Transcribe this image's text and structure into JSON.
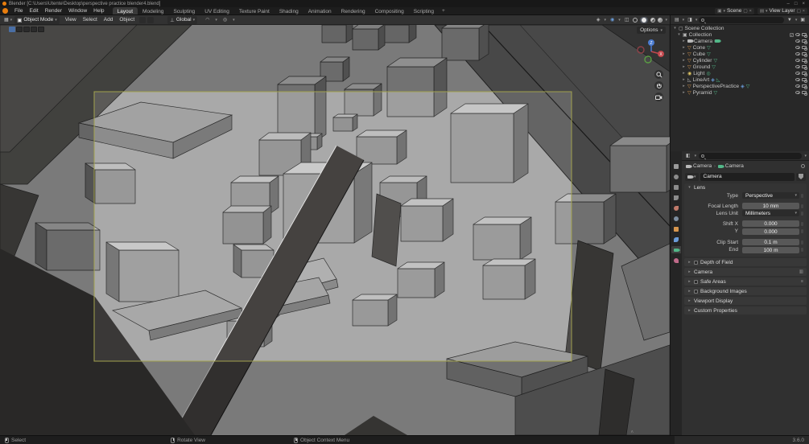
{
  "window": {
    "title": "Blender [C:\\Users\\Utente\\Desktop\\perspective practice blender4.blend]",
    "minimize": "–",
    "maximize": "□",
    "close": "×"
  },
  "menubar": {
    "menus": [
      "File",
      "Edit",
      "Render",
      "Window",
      "Help"
    ],
    "tabs": [
      "Layout",
      "Modeling",
      "Sculpting",
      "UV Editing",
      "Texture Paint",
      "Shading",
      "Animation",
      "Rendering",
      "Compositing",
      "Scripting"
    ],
    "active_tab": "Layout",
    "add_workspace": "+",
    "scene_selector": {
      "label": "Scene"
    },
    "view_layer_selector": {
      "label": "View Layer"
    }
  },
  "viewport_header": {
    "mode": "Object Mode",
    "menus": [
      "View",
      "Select",
      "Add",
      "Object"
    ],
    "orientation": "Global",
    "options_label": "Options"
  },
  "outliner": {
    "root": "Scene Collection",
    "collection": "Collection",
    "items": [
      {
        "name": "Camera"
      },
      {
        "name": "Cone"
      },
      {
        "name": "Cube"
      },
      {
        "name": "Cylinder"
      },
      {
        "name": "Ground"
      },
      {
        "name": "Light"
      },
      {
        "name": "LineArt"
      },
      {
        "name": "PerspectivePractice"
      },
      {
        "name": "Pyramid"
      }
    ]
  },
  "properties": {
    "breadcrumb_object": "Camera",
    "breadcrumb_sep": "›",
    "breadcrumb_data": "Camera",
    "datablock_name": "Camera",
    "lens_panel": {
      "title": "Lens",
      "type_label": "Type",
      "type_value": "Perspective",
      "focal_label": "Focal Length",
      "focal_value": "10 mm",
      "unit_label": "Lens Unit",
      "unit_value": "Millimeters",
      "shiftx_label": "Shift X",
      "shiftx_value": "0.000",
      "shifty_label": "Y",
      "shifty_value": "0.000",
      "clip_label": "Clip Start",
      "clip_value": "0.1 m",
      "end_label": "End",
      "end_value": "100 m"
    },
    "collapsed_panels": [
      {
        "title": "Depth of Field",
        "checkbox": true
      },
      {
        "title": "Camera",
        "checkbox": false
      },
      {
        "title": "Safe Areas",
        "checkbox": true
      },
      {
        "title": "Background Images",
        "checkbox": true
      },
      {
        "title": "Viewport Display",
        "checkbox": false
      },
      {
        "title": "Custom Properties",
        "checkbox": false
      }
    ]
  },
  "statusbar": {
    "items": [
      {
        "label": "Select"
      },
      {
        "label": "Rotate View"
      },
      {
        "label": "Object Context Menu"
      }
    ],
    "version": "3.6.0"
  },
  "colors": {
    "accent_blue": "#4a6fa5",
    "camera_frame": "#a2a24e",
    "blender_orange": "#e87d0d",
    "mesh_icon_orange": "#d7964e",
    "data_icon_green": "#52b788"
  }
}
